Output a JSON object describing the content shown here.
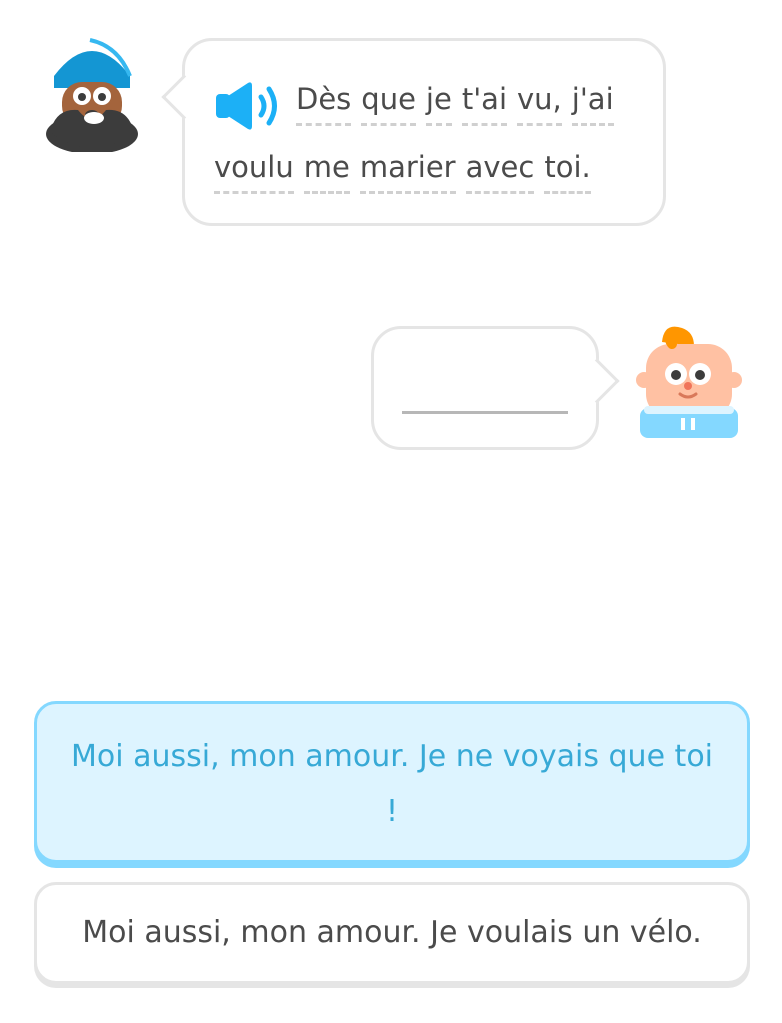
{
  "exercise": {
    "prompt": {
      "words_line1": [
        "Dès",
        "que",
        "je",
        "t'ai",
        "vu,",
        "j'ai"
      ],
      "words_line2": [
        "voulu",
        "me",
        "marier",
        "avec",
        "toi."
      ],
      "speaker_icon": "speaker-icon"
    },
    "answer_blank": "",
    "options": [
      {
        "label": "Moi aussi, mon amour. Je ne voyais que toi !",
        "state": "selected"
      },
      {
        "label": "Moi aussi, mon amour. Je voulais un vélo.",
        "state": "default"
      }
    ]
  },
  "colors": {
    "accent": "#1cb0f6",
    "selected_bg": "#ddf4ff",
    "selected_border": "#84d8ff",
    "selected_text": "#37a9d6",
    "border": "#e5e5e5",
    "text": "#4b4b4b",
    "dash": "#d0d0d0"
  }
}
